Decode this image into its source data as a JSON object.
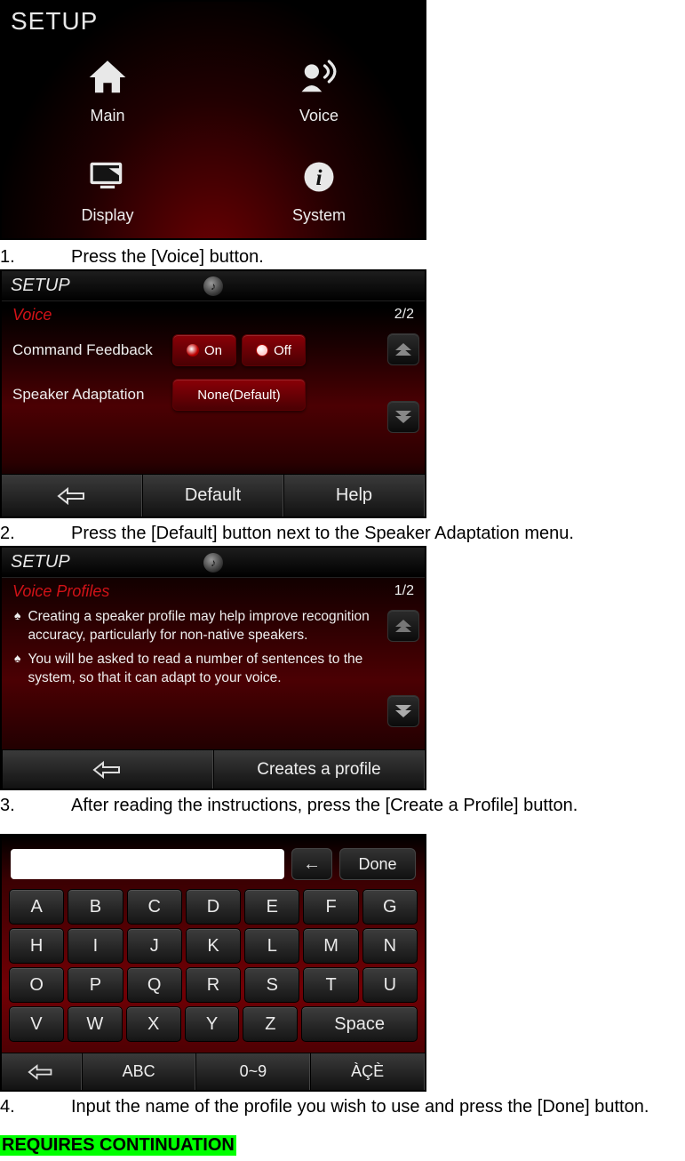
{
  "screen1": {
    "title": "SETUP",
    "items": [
      {
        "label": "Main",
        "icon": "home-icon"
      },
      {
        "label": "Voice",
        "icon": "voice-icon"
      },
      {
        "label": "Display",
        "icon": "display-icon"
      },
      {
        "label": "System",
        "icon": "system-icon"
      }
    ]
  },
  "step1": {
    "num": "1.",
    "text": "Press the [Voice] button."
  },
  "screen2": {
    "topTitle": "SETUP",
    "section": "Voice",
    "page": "2/2",
    "rows": {
      "commandFeedback": {
        "label": "Command Feedback",
        "on": "On",
        "off": "Off"
      },
      "speakerAdaptation": {
        "label": "Speaker Adaptation",
        "value": "None(Default)"
      }
    },
    "bottom": {
      "default": "Default",
      "help": "Help"
    }
  },
  "step2": {
    "num": "2.",
    "text": "Press the [Default] button next to the Speaker Adaptation menu."
  },
  "screen3": {
    "topTitle": "SETUP",
    "section": "Voice Profiles",
    "page": "1/2",
    "bullets": [
      "Creating a speaker profile may help improve recognition accuracy, particularly for non-native speakers.",
      "You will be asked to read a number of sentences to the system, so that it can adapt to your voice."
    ],
    "bottom": {
      "create": "Creates a profile"
    }
  },
  "step3": {
    "num": "3.",
    "text": "After reading the instructions, press the [Create a Profile] button."
  },
  "screen4": {
    "done": "Done",
    "rows": [
      [
        "A",
        "B",
        "C",
        "D",
        "E",
        "F",
        "G"
      ],
      [
        "H",
        "I",
        "J",
        "K",
        "L",
        "M",
        "N"
      ],
      [
        "O",
        "P",
        "Q",
        "R",
        "S",
        "T",
        "U"
      ],
      [
        "V",
        "W",
        "X",
        "Y",
        "Z"
      ]
    ],
    "space": "Space",
    "bottom": {
      "abc": "ABC",
      "num": "0~9",
      "acc": "ÀÇÈ"
    }
  },
  "step4": {
    "num": "4.",
    "text": "Input the name of the profile you wish to use and press the [Done] button."
  },
  "continuation": "REQUIRES CONTINUATION"
}
